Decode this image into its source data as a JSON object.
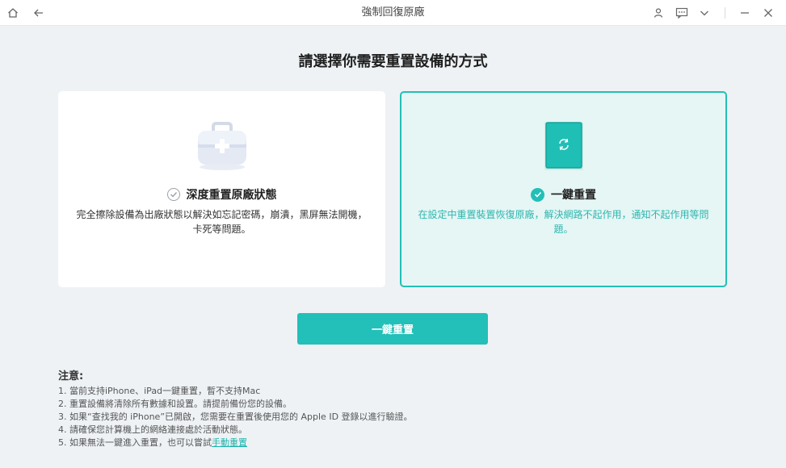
{
  "window": {
    "title": "強制回復原廠",
    "icons": [
      "home-icon",
      "back-arrow-icon",
      "user-icon",
      "feedback-icon",
      "chevron-down-icon",
      "minimize-icon",
      "close-icon"
    ]
  },
  "heading": "請選擇你需要重置設備的方式",
  "options": [
    {
      "title": "深度重置原廠狀態",
      "description": "完全擦除設備為出廠狀態以解決如忘記密碼，崩潰，黑屏無法開機，卡死等問題。",
      "selected": false,
      "icon": "toolbox-icon"
    },
    {
      "title": "一鍵重置",
      "description": "在設定中重置裝置恢復原廠，解決網路不起作用，通知不起作用等問題。",
      "selected": true,
      "icon": "phone-reset-icon"
    }
  ],
  "action_button": "一鍵重置",
  "notes": {
    "title": "注意:",
    "items": [
      "1. 當前支持iPhone、iPad一鍵重置，暫不支持Mac",
      "2. 重置設備將清除所有數據和設置。請提前備份您的設備。",
      "3. 如果“查找我的 iPhone”已開啟，您需要在重置後使用您的 Apple ID 登錄以進行驗證。",
      "4. 請確保您計算機上的網絡連接處於活動狀態。"
    ],
    "last_prefix": "5. 如果無法一鍵進入重置，也可以嘗試",
    "last_link": "手動重置"
  },
  "colors": {
    "accent": "#22c0b8",
    "selected_bg": "#e5f6f5",
    "background": "#eef2f5"
  }
}
